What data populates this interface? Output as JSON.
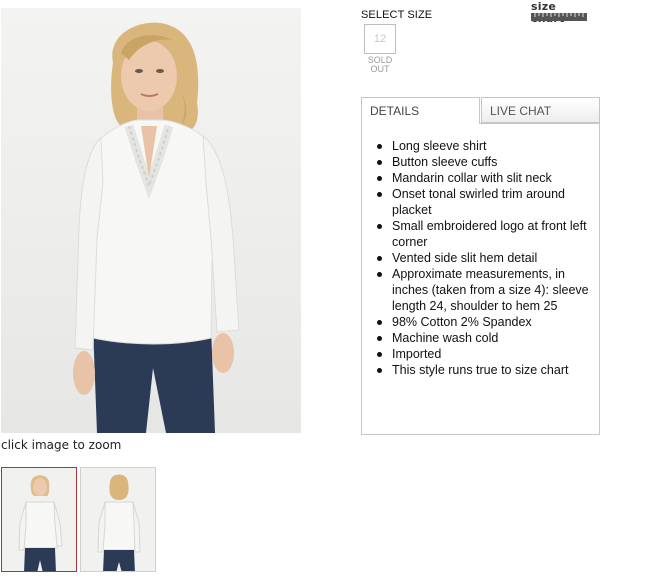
{
  "gallery": {
    "main_image_alt": "Model wearing white long sleeve shirt with embellished mandarin collar",
    "zoom_caption": "click image to zoom",
    "thumbnails": [
      {
        "view": "front",
        "selected": true
      },
      {
        "view": "back",
        "selected": false
      }
    ]
  },
  "size_selector": {
    "label": "SELECT SIZE",
    "size_chart_link": "size chart",
    "sizes": [
      {
        "value": "12",
        "status_line1": "SOLD",
        "status_line2": "OUT"
      }
    ]
  },
  "tabs": [
    {
      "label": "DETAILS",
      "active": true
    },
    {
      "label": "LIVE CHAT",
      "active": false
    }
  ],
  "details": {
    "items": [
      "Long sleeve shirt",
      "Button sleeve cuffs",
      "Mandarin collar with slit neck",
      "Onset tonal swirled trim around placket",
      "Small embroidered logo at front left corner",
      "Vented side slit hem detail",
      "Approximate measurements, in inches (taken from a size 4): sleeve length 24, shoulder to hem 25",
      "98% Cotton 2% Spandex",
      "Machine wash cold",
      "Imported",
      "This style runs true to size chart"
    ]
  },
  "colors": {
    "shirt": "#f7f7f5",
    "pants": "#2b3a55",
    "hair": "#d9b77c",
    "skin": "#e8c3a8",
    "active_thumb_border": "#aa3333"
  }
}
